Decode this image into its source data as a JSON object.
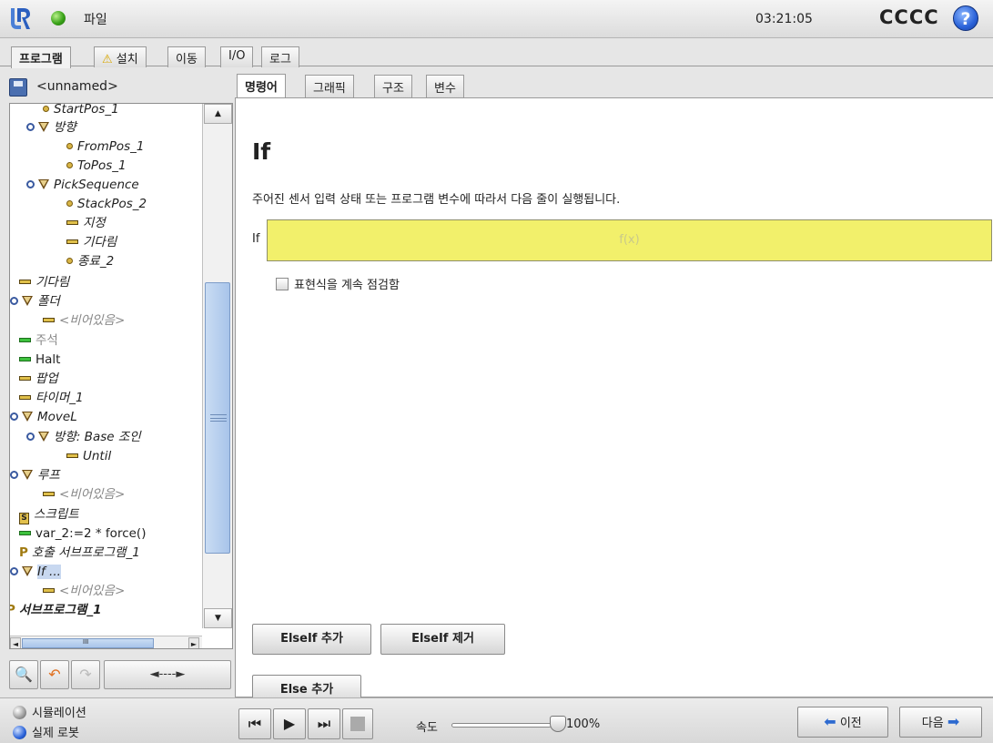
{
  "header": {
    "file_label": "파일",
    "clock": "03:21:05",
    "robot_name": "CCCC",
    "help": "?"
  },
  "main_tabs": [
    "프로그램",
    "설치",
    "이동",
    "I/O",
    "로그"
  ],
  "left_panel": {
    "program_name": "<unnamed>",
    "tree": [
      {
        "label": "StartPos_1"
      },
      {
        "label": "방향"
      },
      {
        "label": "FromPos_1"
      },
      {
        "label": "ToPos_1"
      },
      {
        "label": "PickSequence"
      },
      {
        "label": "StackPos_2"
      },
      {
        "label": "지정"
      },
      {
        "label": "기다림"
      },
      {
        "label": "종료_2"
      },
      {
        "label": "기다림"
      },
      {
        "label": "폴더"
      },
      {
        "label": "<비어있음>"
      },
      {
        "label": "주석"
      },
      {
        "label": "Halt"
      },
      {
        "label": "팝업"
      },
      {
        "label": "타이머_1"
      },
      {
        "label": "MoveL"
      },
      {
        "label": "방향: Base 조인"
      },
      {
        "label": "Until"
      },
      {
        "label": "루프"
      },
      {
        "label": "<비어있음>"
      },
      {
        "label": "스크립트"
      },
      {
        "label": "var_2:=2 * force()"
      },
      {
        "label": "호출 서브프로그램_1"
      },
      {
        "label": "If ..."
      },
      {
        "label": "<비어있음>"
      },
      {
        "label": "서브프로그램_1"
      }
    ],
    "hscroll_mark": "III",
    "arrows": "◄----►"
  },
  "sub_tabs": [
    "명령어",
    "그래픽",
    "구조",
    "변수"
  ],
  "command": {
    "title": "If",
    "description": "주어진 센서 입력 상태 또는 프로그램 변수에 따라서 다음 줄이 실행됩니다.",
    "if_label": "If",
    "expression_placeholder": "f(x)",
    "checkbox_label": "표현식을 계속 점검함",
    "add_elseif": "ElseIf 추가",
    "remove_elseif": "ElseIf 제거",
    "add_else": "Else 추가"
  },
  "footer": {
    "mode_sim": "시뮬레이션",
    "mode_real": "실제 로봇",
    "speed_label": "속도",
    "speed_value": "100%",
    "speed_fraction": 1.0,
    "prev": "이전",
    "next": "다음"
  },
  "colors": {
    "expression_bg": "#f2f06b",
    "status_ok": "#3aa319",
    "accent_blue": "#2d6ad0"
  }
}
